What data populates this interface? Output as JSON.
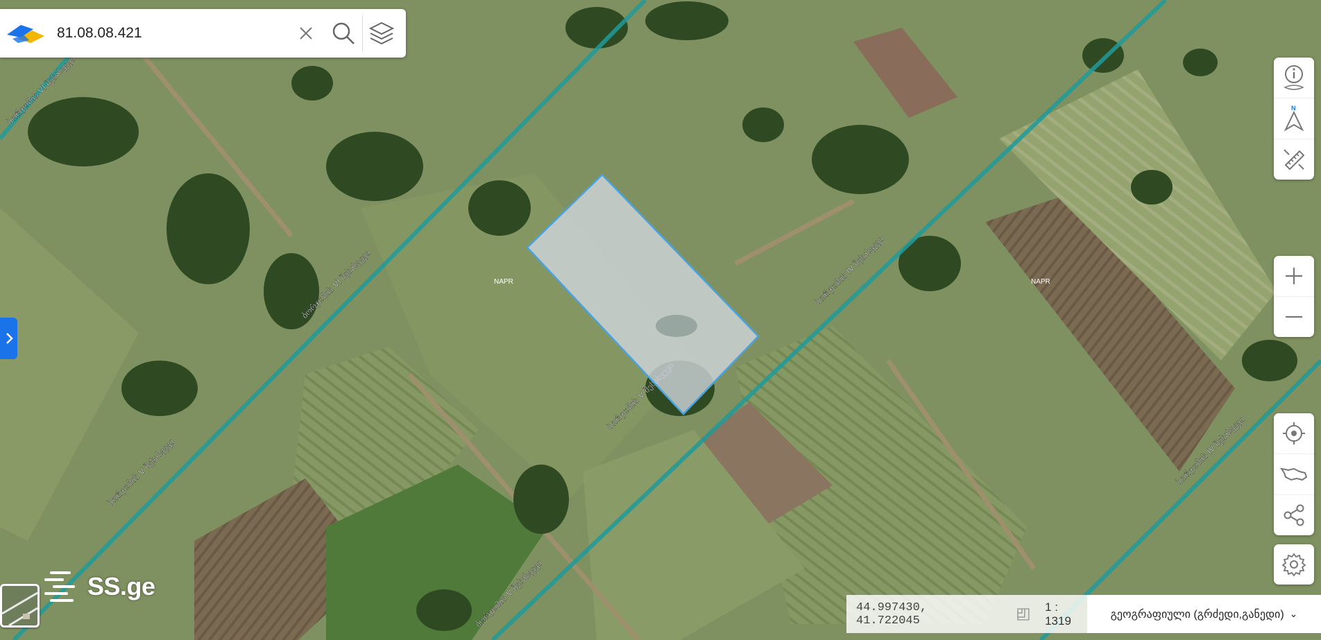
{
  "search": {
    "value": "81.08.08.421",
    "clear_icon": "close-icon",
    "search_icon": "search-icon",
    "layers_icon": "layers-icon"
  },
  "map": {
    "parcel_labels": [
      "NAPR",
      "NAPR"
    ],
    "street_labels": [
      "ბორჯომის VI შესახვევი",
      "ბორჯომის VI შესახვევი",
      "ბორჯომის V შესახვევი",
      "ბორჯომის V შესახვევი",
      "ბორჯომის V შესახვევი",
      "ბორჯომის IV შესახვევი",
      "ბორჯომის IV შესახვევი"
    ]
  },
  "toolbar_top": [
    "info-icon",
    "compass-north-icon",
    "ruler-icon"
  ],
  "zoom": {
    "in_icon": "plus-icon",
    "out_icon": "minus-icon"
  },
  "toolbar_bottom": [
    "locate-icon",
    "georgia-map-icon",
    "share-icon"
  ],
  "settings_icon": "gear-icon",
  "brand": {
    "text": "SS.ge"
  },
  "status": {
    "coords": "44.997430, 41.722045",
    "scale": "1 : 1319",
    "projection": "გეოგრაფიული (გრძედი,განედი)"
  },
  "colors": {
    "accent": "#1a73e8",
    "road": "#1f9a99",
    "parcel_fill": "#cfd6dc",
    "parcel_stroke": "#4aa3e0"
  }
}
